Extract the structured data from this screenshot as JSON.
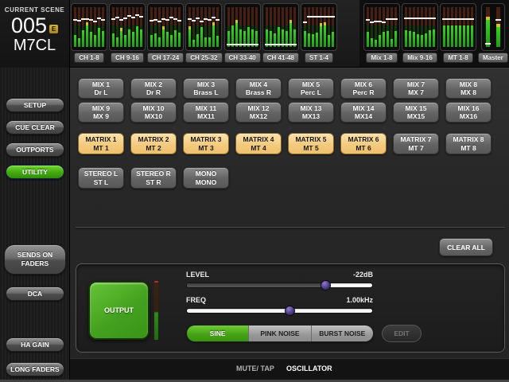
{
  "scene": {
    "label": "CURRENT SCENE",
    "number": "005",
    "edit_badge": "E",
    "name": "M7CL"
  },
  "meter_bridge": {
    "blocks": [
      {
        "label": "CH 1-8",
        "group": "left",
        "green": [
          30,
          22,
          42,
          55,
          38,
          30,
          48,
          40
        ],
        "marks": [
          30,
          32,
          28,
          27,
          30,
          34,
          25,
          30
        ],
        "yellow": [
          3
        ]
      },
      {
        "label": "CH 9-16",
        "group": "left",
        "green": [
          35,
          25,
          40,
          30,
          45,
          38,
          52,
          44
        ],
        "marks": [
          28,
          24,
          30,
          26,
          20,
          24,
          18,
          22
        ],
        "yellow": [
          2
        ]
      },
      {
        "label": "CH 17-24",
        "group": "left",
        "green": [
          30,
          35,
          25,
          45,
          38,
          30,
          42,
          36
        ],
        "marks": [
          32,
          30,
          34,
          28,
          30,
          24,
          28,
          32
        ],
        "yellow": [
          3
        ]
      },
      {
        "label": "CH 25-32",
        "group": "left",
        "green": [
          45,
          18,
          32,
          50,
          25,
          25,
          55,
          28
        ],
        "marks": [
          28,
          32,
          26,
          33,
          28,
          30,
          24,
          30
        ],
        "yellow": [
          0,
          6
        ]
      },
      {
        "label": "CH 33-40",
        "group": "left",
        "green": [
          40,
          55,
          60,
          45,
          40,
          50,
          45,
          40
        ],
        "marks": [
          92,
          92,
          92,
          92,
          92,
          92,
          92,
          92
        ],
        "yellow": [
          2
        ]
      },
      {
        "label": "CH 41-48",
        "group": "left",
        "green": [
          45,
          40,
          35,
          50,
          45,
          40,
          60,
          45
        ],
        "marks": [
          92,
          92,
          92,
          92,
          92,
          92,
          92,
          92
        ],
        "yellow": [
          6
        ]
      },
      {
        "label": "ST 1-4",
        "group": "left",
        "green": [
          40,
          35,
          32,
          36,
          52,
          55,
          30,
          38
        ],
        "marks": [
          36,
          22,
          22,
          22,
          22,
          22,
          22,
          22
        ],
        "yellow": [
          4,
          5
        ]
      },
      {
        "label": "Mix 1-8",
        "group": "right",
        "green": [
          38,
          22,
          18,
          30,
          38,
          40,
          20,
          40
        ],
        "marks": [
          30,
          36,
          33,
          33,
          36,
          28,
          28,
          28
        ],
        "yellow": []
      },
      {
        "label": "Mix 9-16",
        "group": "right",
        "green": [
          42,
          40,
          38,
          32,
          30,
          35,
          42,
          45
        ],
        "marks": [
          26,
          26,
          26,
          26,
          26,
          26,
          26,
          26
        ],
        "yellow": []
      },
      {
        "label": "MT 1-8",
        "group": "right",
        "green": [
          55,
          55,
          55,
          55,
          55,
          55,
          55,
          55
        ],
        "marks": [
          28,
          28,
          28,
          28,
          28,
          28,
          28,
          28
        ],
        "yellow": []
      },
      {
        "label": "Master",
        "group": "right",
        "narrow": true,
        "green": [
          68,
          50
        ],
        "marks": [
          90,
          30
        ],
        "yellow": [
          0,
          1
        ]
      }
    ]
  },
  "sidebar": {
    "buttons": [
      {
        "label": "SETUP",
        "active": false
      },
      {
        "label": "CUE CLEAR",
        "active": false
      },
      {
        "label": "OUTPORTS",
        "active": false
      },
      {
        "label": "UTILITY",
        "active": true
      },
      {
        "label": "SENDS ON\nFADERS",
        "active": false
      },
      {
        "label": "DCA",
        "active": false
      },
      {
        "label": "HA GAIN",
        "active": false
      },
      {
        "label": "LONG FADERS",
        "active": false
      }
    ]
  },
  "bus_grid": {
    "rows": [
      [
        {
          "l1": "MIX 1",
          "l2": "Dr L",
          "on": false
        },
        {
          "l1": "MIX 2",
          "l2": "Dr R",
          "on": false
        },
        {
          "l1": "MIX 3",
          "l2": "Brass L",
          "on": false
        },
        {
          "l1": "MIX 4",
          "l2": "Brass R",
          "on": false
        },
        {
          "l1": "MIX 5",
          "l2": "Perc L",
          "on": false
        },
        {
          "l1": "MIX 6",
          "l2": "Perc R",
          "on": false
        },
        {
          "l1": "MIX 7",
          "l2": "MX 7",
          "on": false
        },
        {
          "l1": "MIX 8",
          "l2": "MX 8",
          "on": false
        }
      ],
      [
        {
          "l1": "MIX 9",
          "l2": "MX 9",
          "on": false
        },
        {
          "l1": "MIX 10",
          "l2": "MX10",
          "on": false
        },
        {
          "l1": "MIX 11",
          "l2": "MX11",
          "on": false
        },
        {
          "l1": "MIX 12",
          "l2": "MX12",
          "on": false
        },
        {
          "l1": "MIX 13",
          "l2": "MX13",
          "on": false
        },
        {
          "l1": "MIX 14",
          "l2": "MX14",
          "on": false
        },
        {
          "l1": "MIX 15",
          "l2": "MX15",
          "on": false
        },
        {
          "l1": "MIX 16",
          "l2": "MX16",
          "on": false
        }
      ],
      [
        {
          "l1": "MATRIX 1",
          "l2": "MT 1",
          "on": true
        },
        {
          "l1": "MATRIX 2",
          "l2": "MT 2",
          "on": true
        },
        {
          "l1": "MATRIX 3",
          "l2": "MT 3",
          "on": true
        },
        {
          "l1": "MATRIX 4",
          "l2": "MT 4",
          "on": true
        },
        {
          "l1": "MATRIX 5",
          "l2": "MT 5",
          "on": true
        },
        {
          "l1": "MATRIX 6",
          "l2": "MT 6",
          "on": true
        },
        {
          "l1": "MATRIX 7",
          "l2": "MT 7",
          "on": false
        },
        {
          "l1": "MATRIX 8",
          "l2": "MT 8",
          "on": false
        }
      ],
      [
        {
          "l1": "STEREO L",
          "l2": "ST L",
          "on": false
        },
        {
          "l1": "STEREO R",
          "l2": "ST R",
          "on": false
        },
        {
          "l1": "MONO",
          "l2": "MONO",
          "on": false
        }
      ]
    ]
  },
  "clear_all_label": "CLEAR ALL",
  "oscillator": {
    "output_label": "OUTPUT",
    "level": {
      "label": "LEVEL",
      "value": "-22dB",
      "percent": 75,
      "filled": true
    },
    "freq": {
      "label": "FREQ",
      "value": "1.00kHz",
      "percent": 56,
      "filled": false
    },
    "waveforms": [
      {
        "label": "SINE",
        "active": true
      },
      {
        "label": "PINK NOISE",
        "active": false
      },
      {
        "label": "BURST NOISE",
        "active": false
      }
    ],
    "edit_label": "EDIT"
  },
  "bottom_tabs": [
    {
      "label": "MUTE/ TAP",
      "active": false
    },
    {
      "label": "OSCILLATOR",
      "active": true
    }
  ],
  "colors": {
    "accent_green": "#47ab15",
    "active_orange": "#f3c97c",
    "knob_purple": "#4c3c82",
    "meter_green": "#35d41e",
    "meter_yellow": "#d3c02a",
    "badge_yellow": "#c9a325"
  }
}
